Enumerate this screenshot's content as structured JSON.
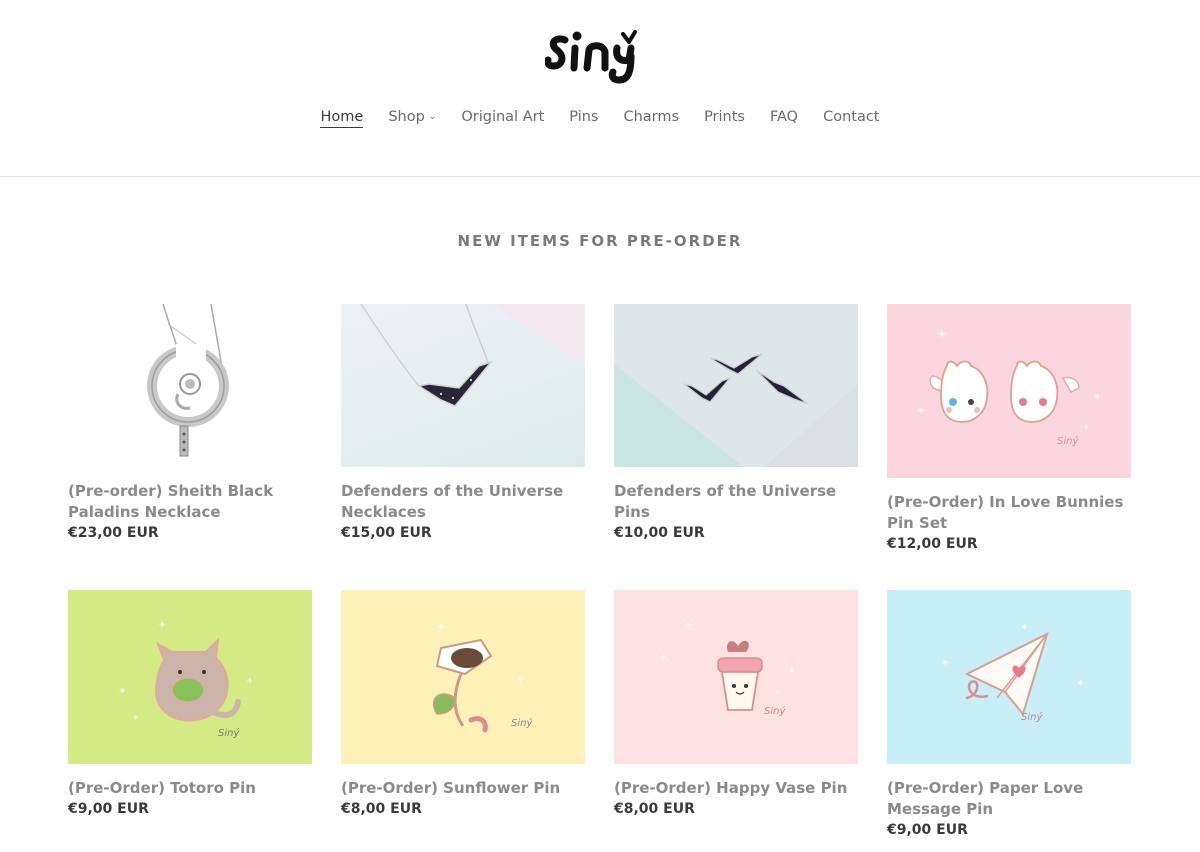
{
  "brand": {
    "logo_text": "Siný"
  },
  "nav": {
    "items": [
      {
        "label": "Home"
      },
      {
        "label": "Shop",
        "chevron": "chevron-down-icon"
      },
      {
        "label": "Original Art"
      },
      {
        "label": "Pins"
      },
      {
        "label": "Charms"
      },
      {
        "label": "Prints"
      },
      {
        "label": "FAQ"
      },
      {
        "label": "Contact"
      }
    ],
    "active": "Home"
  },
  "section": {
    "title": "NEW ITEMS FOR PRE-ORDER"
  },
  "products": [
    {
      "title": "(Pre-order) Sheith Black Paladins Necklace",
      "price": "€23,00 EUR"
    },
    {
      "title": "Defenders of the Universe Necklaces",
      "price": "€15,00 EUR"
    },
    {
      "title": "Defenders of the Universe Pins",
      "price": "€10,00 EUR"
    },
    {
      "title": "(Pre-Order) In Love Bunnies Pin Set",
      "price": "€12,00 EUR"
    },
    {
      "title": "(Pre-Order) Totoro Pin",
      "price": "€9,00 EUR"
    },
    {
      "title": "(Pre-Order) Sunflower Pin",
      "price": "€8,00 EUR"
    },
    {
      "title": "(Pre-Order) Happy Vase Pin",
      "price": "€8,00 EUR"
    },
    {
      "title": "(Pre-Order) Paper Love Message Pin",
      "price": "€9,00 EUR"
    }
  ],
  "colors": {
    "bunnies_bg": "#fcd6df",
    "totoro_bg": "#d4ea84",
    "sunflower_bg": "#fdf1b7",
    "vase_bg": "#fde1e3",
    "plane_bg": "#c8eef8"
  }
}
